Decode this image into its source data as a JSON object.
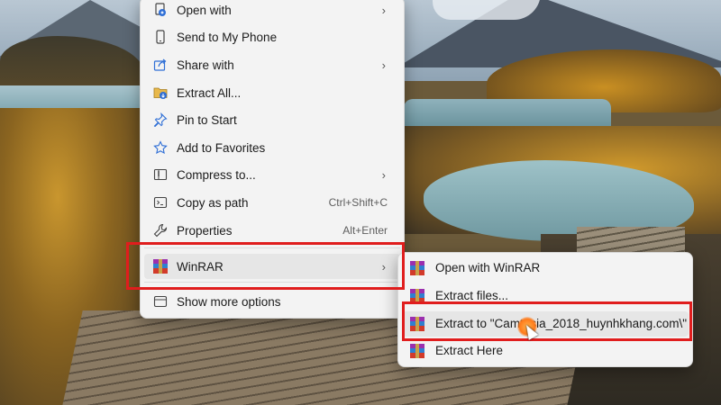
{
  "context_menu": {
    "items": [
      {
        "label": "Open with",
        "icon": "open-with-icon",
        "submenu": true
      },
      {
        "label": "Send to My Phone",
        "icon": "phone-icon"
      },
      {
        "label": "Share with",
        "icon": "share-icon",
        "submenu": true
      },
      {
        "label": "Extract All...",
        "icon": "extract-all-icon"
      },
      {
        "label": "Pin to Start",
        "icon": "pin-icon"
      },
      {
        "label": "Add to Favorites",
        "icon": "star-icon"
      },
      {
        "label": "Compress to...",
        "icon": "compress-icon",
        "submenu": true
      },
      {
        "label": "Copy as path",
        "icon": "copy-path-icon",
        "shortcut": "Ctrl+Shift+C"
      },
      {
        "label": "Properties",
        "icon": "wrench-icon",
        "shortcut": "Alt+Enter"
      }
    ],
    "winrar_item": {
      "label": "WinRAR",
      "icon": "winrar-icon",
      "submenu": true
    },
    "show_more": {
      "label": "Show more options",
      "icon": "show-more-icon"
    },
    "arrow": "›"
  },
  "winrar_submenu": {
    "items": [
      {
        "label": "Open with WinRAR"
      },
      {
        "label": "Extract files..."
      },
      {
        "label": "Extract to \"Camtasia_2018_huynhkhang.com\\\""
      },
      {
        "label": "Extract Here"
      }
    ]
  },
  "colors": {
    "highlight_border": "#e01d1d",
    "menu_bg": "#f3f3f3",
    "accent_blue": "#2f6fd6"
  }
}
